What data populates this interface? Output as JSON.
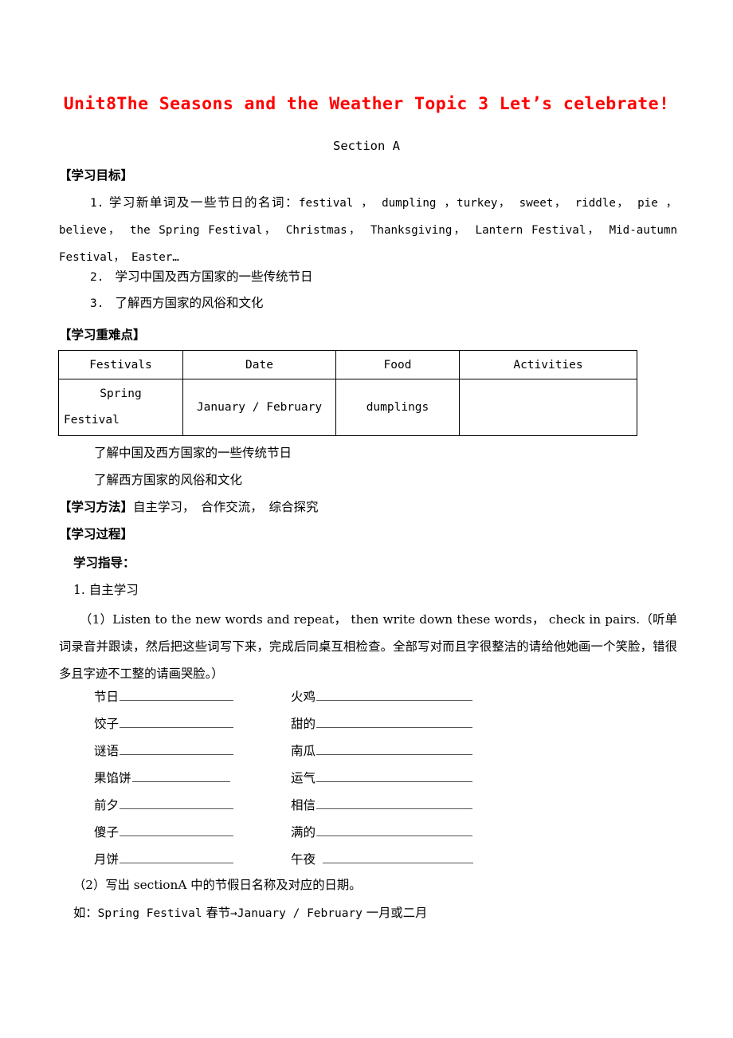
{
  "document": {
    "title": "Unit8The Seasons and the Weather Topic 3 Let’s celebrate!",
    "section_heading": "Section A"
  },
  "objectives": {
    "heading": "【学习目标】",
    "item1_number": "1.",
    "item1_cn_lead": "学习新单词及一些节日的名词：",
    "item1_words": "festival ， dumpling ，turkey， sweet， riddle， pie ，believe， the Spring Festival， Christmas， Thanksgiving， Lantern Festival， Mid-autumn Festival， Easter…",
    "item2_number": "2.",
    "item2_text": "学习中国及西方国家的一些传统节日",
    "item3_number": "3.",
    "item3_text": "了解西方国家的风俗和文化"
  },
  "key_points": {
    "heading": "【学习重难点】",
    "table": {
      "columns": [
        "Festivals",
        "Date",
        "Food",
        "Activities"
      ],
      "rows": [
        {
          "festival_line1": "Spring",
          "festival_line2": "Festival",
          "date": "January / February",
          "food": "dumplings",
          "activities": ""
        }
      ]
    },
    "note1": "了解中国及西方国家的一些传统节日",
    "note2": "了解西方国家的风俗和文化"
  },
  "methods": {
    "heading": "【学习方法】",
    "text": "自主学习，　合作交流，　综合探究"
  },
  "process": {
    "heading": "【学习过程】",
    "guide_heading": "学习指导：",
    "step1": "1. 自主学习",
    "item1": "（1）Listen to the new words and repeat， then write down these words， check in pairs.（听单词录音并跟读，然后把这些词写下来，完成后同桌互相检查。全部写对而且字很整洁的请给他她画一个笑脸，错很多且字迹不工整的请画哭脸。）",
    "vocab_rows": [
      {
        "left": "节日",
        "right": "火鸡"
      },
      {
        "left": "饺子",
        "right": "甜的"
      },
      {
        "left": "谜语",
        "right": "南瓜"
      },
      {
        "left": "果馅饼",
        "right": "运气"
      },
      {
        "left": "前夕",
        "right": "相信"
      },
      {
        "left": "傻子",
        "right": "满的"
      },
      {
        "left": "月饼",
        "right": "午夜"
      }
    ],
    "item2": "（2）写出 sectionA 中的节假日名称及对应的日期。",
    "example_prefix": "如：",
    "example_en1": "Spring Festival",
    "example_cn1": "春节",
    "example_arrow": "→",
    "example_en2": "January / February",
    "example_cn2": "一月或二月"
  },
  "colors": {
    "title_red": "#ff0000",
    "text_black": "#000000",
    "rule_gray": "#555555"
  }
}
